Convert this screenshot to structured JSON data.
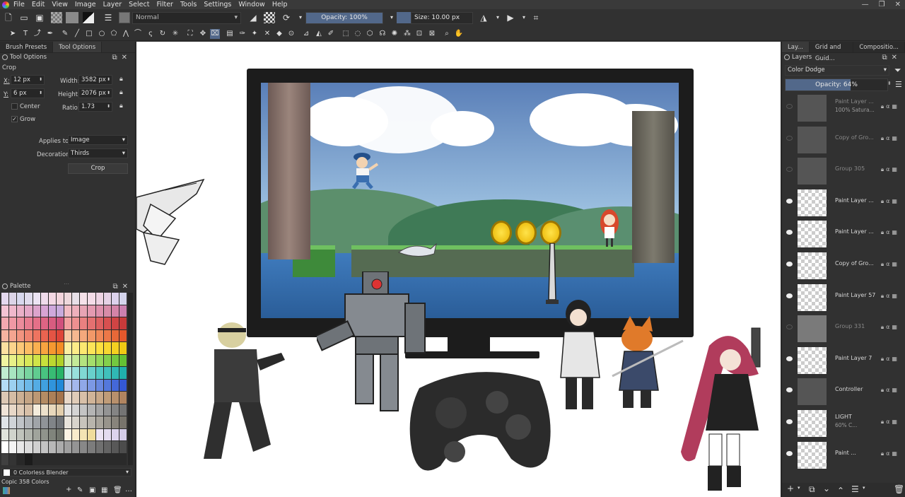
{
  "menubar": {
    "items": [
      "File",
      "Edit",
      "View",
      "Image",
      "Layer",
      "Select",
      "Filter",
      "Tools",
      "Settings",
      "Window",
      "Help"
    ]
  },
  "toolbar": {
    "blend_mode": "Normal",
    "opacity": "Opacity: 100%",
    "opacity_fraction": 1.0,
    "size": "Size: 10.00 px"
  },
  "left_dock": {
    "tabs": [
      "Brush Presets",
      "Tool Options"
    ],
    "panel_title": "Tool Options",
    "tool_name": "Crop",
    "x_label": "X:",
    "x_value": "12 px",
    "y_label": "Y:",
    "y_value": "6 px",
    "width_label": "Width:",
    "width_value": "3582 px",
    "height_label": "Height:",
    "height_value": "2076 px",
    "ratio_label": "Ratio:",
    "ratio_value": "1.73",
    "center_label": "Center",
    "grow_label": "Grow",
    "applies_to_label": "Applies to:",
    "applies_to_value": "Image",
    "decoration_label": "Decoration:",
    "decoration_value": "Thirds",
    "crop_button": "Crop"
  },
  "palette": {
    "title": "Palette",
    "current_color": "0 Colorless Blender",
    "palette_name": "Copic 358 Colors",
    "colors": [
      "#e4d8ee",
      "#dcd4e8",
      "#d8d8ee",
      "#e0dcee",
      "#ece4f4",
      "#f0dcec",
      "#f4d8e4",
      "#f2d4dc",
      "#eed8dc",
      "#e8e0e8",
      "#f6e2ea",
      "#f4dce8",
      "#eed4e4",
      "#e6d2e6",
      "#dcd2ec",
      "#d4d4ec",
      "#f4c4d4",
      "#f0b8cc",
      "#eab0c8",
      "#e4a8c8",
      "#dca4cc",
      "#d8a4d4",
      "#cfa8dc",
      "#c8aadc",
      "#f2bcc4",
      "#eeb0bc",
      "#e8a4b4",
      "#e49ab0",
      "#de90ac",
      "#d88ca8",
      "#d484a8",
      "#cc80b0",
      "#f4a8b0",
      "#f098a4",
      "#ec8c9c",
      "#e87c90",
      "#e47088",
      "#de6484",
      "#d85c80",
      "#d0507c",
      "#f2a0a0",
      "#ee9090",
      "#ea8080",
      "#e47070",
      "#de6060",
      "#d85050",
      "#d04444",
      "#c83a3a",
      "#f6b4a0",
      "#f4a490",
      "#f29480",
      "#f08470",
      "#ee7460",
      "#ea6450",
      "#e45444",
      "#de4438",
      "#f8c8a4",
      "#f6b890",
      "#f4a87c",
      "#f29868",
      "#f08858",
      "#ec7848",
      "#e86838",
      "#e4582c",
      "#fce0a0",
      "#fcd48c",
      "#fcc878",
      "#fcbc64",
      "#fab050",
      "#f8a440",
      "#f69830",
      "#f48c24",
      "#fcf0a0",
      "#fcec88",
      "#fce870",
      "#fce458",
      "#fce040",
      "#f8d830",
      "#f4d020",
      "#f0c814",
      "#f0f4a0",
      "#e8f088",
      "#e0ec70",
      "#d8e858",
      "#d0e448",
      "#c8e03c",
      "#bcd830",
      "#b0d028",
      "#d4f0b0",
      "#c4ea98",
      "#b4e480",
      "#a4de6c",
      "#94d85c",
      "#84d04c",
      "#74c840",
      "#64c034",
      "#c0ecd0",
      "#a8e4c0",
      "#90dcb0",
      "#78d4a0",
      "#60cc90",
      "#48c480",
      "#38bc74",
      "#28b468",
      "#b0e8e4",
      "#98e0dc",
      "#80d8d4",
      "#68d0cc",
      "#50c8c4",
      "#40c0bc",
      "#30b8b4",
      "#20b0ac",
      "#b4dcf4",
      "#9cd0f0",
      "#84c4ec",
      "#6cb8e8",
      "#54ace4",
      "#40a0e0",
      "#3094dc",
      "#2088d8",
      "#b8c8f0",
      "#a4b8ec",
      "#90a8e8",
      "#7c98e4",
      "#6888e0",
      "#5478dc",
      "#4468d8",
      "#3458d4",
      "#dcc8b4",
      "#d4bca4",
      "#ccb094",
      "#c4a484",
      "#bc9874",
      "#b48c64",
      "#ac8058",
      "#a4744c",
      "#e8d8c8",
      "#e0ccb8",
      "#d8c0a8",
      "#d0b498",
      "#c8a888",
      "#c09c78",
      "#b8906c",
      "#b08460",
      "#f0e4d8",
      "#e8d8c8",
      "#e0ccb8",
      "#d8c0a8",
      "#f4ecdc",
      "#eee2cc",
      "#e8d8bc",
      "#e2ceac",
      "#e4e4e4",
      "#d4d4d4",
      "#c4c4c4",
      "#b4b4b4",
      "#a4a4a4",
      "#949494",
      "#848484",
      "#747474",
      "#e0e4e8",
      "#d0d4d8",
      "#c0c4c8",
      "#b0b4b8",
      "#a0a4a8",
      "#909498",
      "#808488",
      "#707478",
      "#e8e4dc",
      "#d8d4cc",
      "#c8c4bc",
      "#b8b4ac",
      "#a8a49c",
      "#98948c",
      "#88847c",
      "#78746c",
      "#e0e4dc",
      "#d0d4cc",
      "#c0c4bc",
      "#b0b4ac",
      "#a0a49c",
      "#90948c",
      "#80847c",
      "#70746c",
      "#fcf4e4",
      "#f8eccc",
      "#f4e4b4",
      "#f0dc9c",
      "#ece4f4",
      "#e4dcf0",
      "#dcd4ec",
      "#d4ccE8",
      "#ffffff",
      "#f4f4f4",
      "#e8e8e8",
      "#dcdcdc",
      "#d0d0d0",
      "#c4c4c4",
      "#b8b8b8",
      "#acacac",
      "#a0a0a0",
      "#949494",
      "#888888",
      "#7c7c7c",
      "#707070",
      "#646464",
      "#585858",
      "#4c4c4c",
      "#404040",
      "#343434",
      "#282828",
      "#1c1c1c"
    ]
  },
  "right_dock": {
    "tabs": [
      "Lay...",
      "Grid and Guid...",
      "Compositio..."
    ],
    "panel_title": "Layers",
    "blend_mode": "Color Dodge",
    "opacity": "Opacity:  64%",
    "opacity_fraction": 0.64,
    "layers": [
      {
        "name": "Paint Layer ...",
        "sub": "100% Satura...",
        "visible": false,
        "thumb": "dark"
      },
      {
        "name": "Copy of Gro...",
        "sub": "",
        "visible": false,
        "thumb": "dark"
      },
      {
        "name": "Group 305",
        "sub": "",
        "visible": false,
        "thumb": "dark"
      },
      {
        "name": "Paint Layer ...",
        "sub": "",
        "visible": true,
        "thumb": "check"
      },
      {
        "name": "Paint Layer ...",
        "sub": "",
        "visible": true,
        "thumb": "check"
      },
      {
        "name": "Copy of Gro...",
        "sub": "",
        "visible": true,
        "thumb": "check"
      },
      {
        "name": "Paint Layer 57",
        "sub": "",
        "visible": true,
        "thumb": "check"
      },
      {
        "name": "Group 331",
        "sub": "",
        "visible": false,
        "thumb": "gray"
      },
      {
        "name": "Paint Layer 7",
        "sub": "",
        "visible": true,
        "thumb": "check"
      },
      {
        "name": "Controller",
        "sub": "",
        "visible": true,
        "thumb": "dark"
      },
      {
        "name": "LIGHT",
        "sub": "60% C...",
        "visible": true,
        "thumb": "check"
      },
      {
        "name": "Paint ...",
        "sub": "",
        "visible": true,
        "thumb": "check"
      }
    ]
  }
}
